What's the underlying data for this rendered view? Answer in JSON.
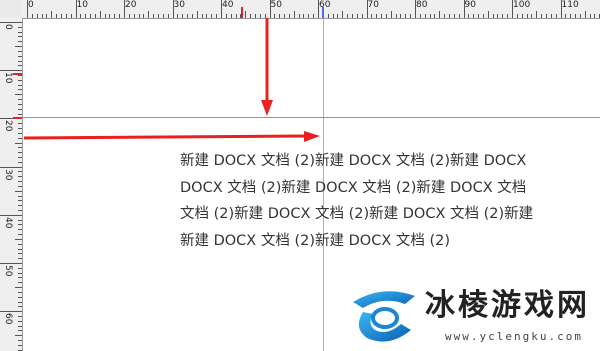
{
  "colors": {
    "guide_vertical": "#f5a623",
    "guide_horizontal": "#c86bd6",
    "arrow": "#e8201f",
    "ruler_marker_red": "#e8201f",
    "ruler_marker_blue": "#4a6cf0",
    "text": "#333333",
    "logo_blue": "#1a86d8"
  },
  "ruler": {
    "horizontal_labels": [
      "0",
      "10",
      "20",
      "30",
      "40",
      "50",
      "60",
      "70",
      "80",
      "90",
      "100",
      "110"
    ],
    "vertical_labels": [
      "0",
      "10",
      "20",
      "30",
      "40",
      "50",
      "60"
    ]
  },
  "document": {
    "lines": [
      "新建  DOCX  文档  (2)新建  DOCX  文档  (2)新建  DOCX",
      "DOCX  文档  (2)新建  DOCX  文档  (2)新建  DOCX  文档",
      "文档  (2)新建  DOCX  文档  (2)新建  DOCX  文档  (2)新建",
      "新建  DOCX  文档  (2)新建  DOCX  文档  (2)"
    ]
  },
  "watermark": {
    "title": "冰棱游戏网",
    "url": "www.yclengku.com",
    "icon": "ice-logo-icon"
  }
}
